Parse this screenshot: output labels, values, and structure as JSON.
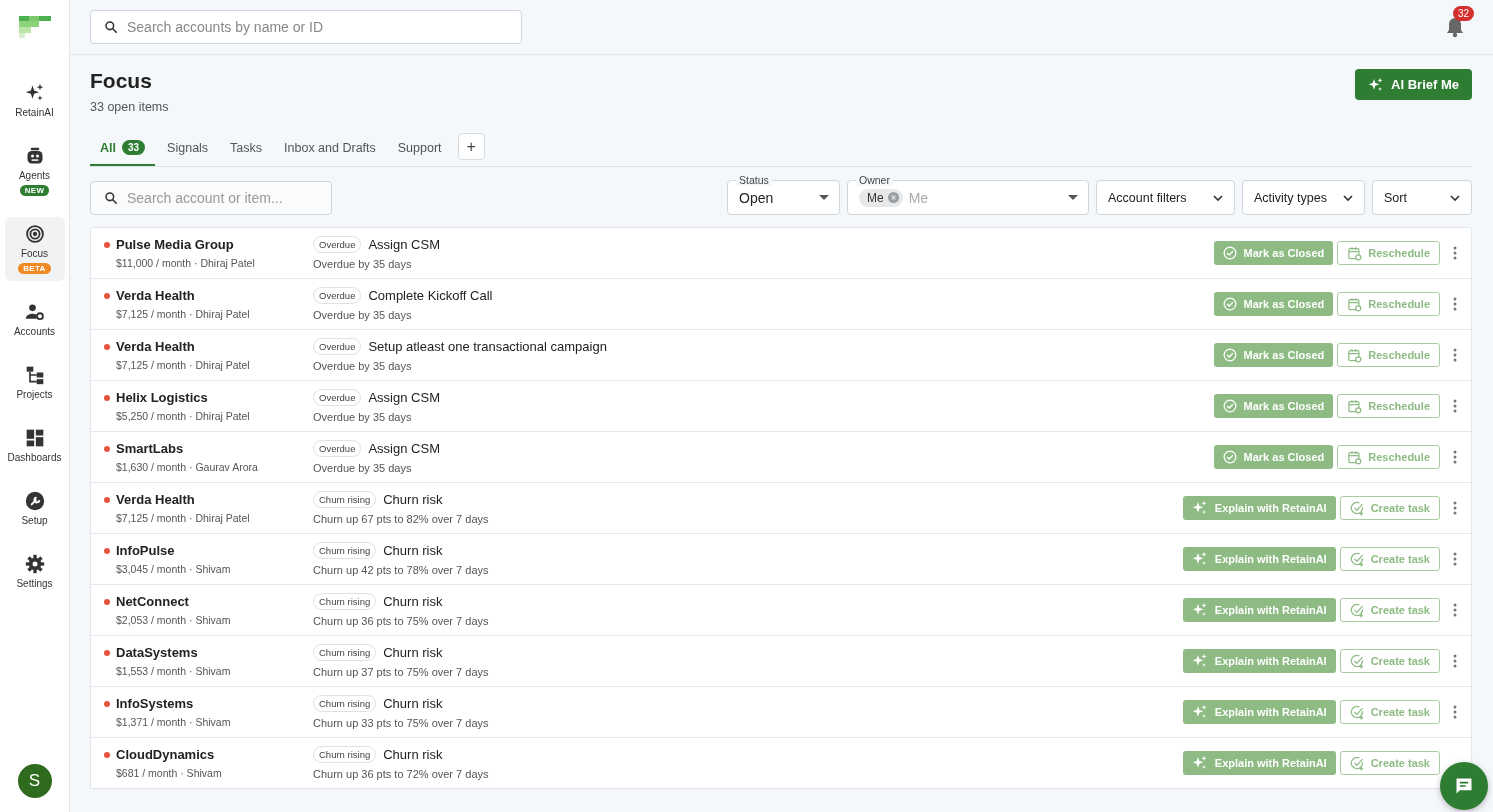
{
  "topbar": {
    "search": {
      "placeholder": "Search accounts by name or ID"
    },
    "notifications": "32"
  },
  "sidebar": {
    "items": [
      {
        "label": "RetainAI",
        "selected": false
      },
      {
        "label": "Agents",
        "badge": "NEW",
        "color": "#2e7d32",
        "selected": false
      },
      {
        "label": "Focus",
        "badge": "BETA",
        "color": "#f08a24",
        "selected": true
      },
      {
        "label": "Accounts",
        "selected": false
      },
      {
        "label": "Projects",
        "selected": false
      },
      {
        "label": "Dashboards",
        "selected": false
      },
      {
        "label": "Setup",
        "selected": false
      },
      {
        "label": "Settings",
        "selected": false
      }
    ],
    "avatar": "S"
  },
  "header": {
    "title": "Focus",
    "subtitle": "33 open items",
    "action": "AI Brief Me"
  },
  "tabs": [
    {
      "label": "All",
      "count": "33",
      "selected": true
    },
    {
      "label": "Signals",
      "selected": false
    },
    {
      "label": "Tasks",
      "selected": false
    },
    {
      "label": "Inbox and Drafts",
      "selected": false
    },
    {
      "label": "Support",
      "selected": false
    }
  ],
  "add_tab": "+",
  "filters": {
    "search": {
      "placeholder": "Search account or item..."
    },
    "status": {
      "label": "Status",
      "value": "Open"
    },
    "owner": {
      "label": "Owner",
      "chip": "Me",
      "placeholder": "Me"
    },
    "dropdowns": [
      "Account filters",
      "Activity types",
      "Sort"
    ]
  },
  "items": [
    {
      "kind": "overdue",
      "account": "Pulse Media Group",
      "meta": "$11,000 / month · Dhiraj Patel",
      "tag": "Overdue",
      "title": "Assign CSM",
      "detail": "Overdue by 35 days",
      "actions": [
        "Mark as Closed",
        "Reschedule"
      ]
    },
    {
      "kind": "overdue",
      "account": "Verda Health",
      "meta": "$7,125 / month · Dhiraj Patel",
      "tag": "Overdue",
      "title": "Complete Kickoff Call",
      "detail": "Overdue by 35 days",
      "actions": [
        "Mark as Closed",
        "Reschedule"
      ]
    },
    {
      "kind": "overdue",
      "account": "Verda Health",
      "meta": "$7,125 / month · Dhiraj Patel",
      "tag": "Overdue",
      "title": "Setup atleast one transactional campaign",
      "detail": "Overdue by 35 days",
      "actions": [
        "Mark as Closed",
        "Reschedule"
      ]
    },
    {
      "kind": "overdue",
      "account": "Helix Logistics",
      "meta": "$5,250 / month · Dhiraj Patel",
      "tag": "Overdue",
      "title": "Assign CSM",
      "detail": "Overdue by 35 days",
      "actions": [
        "Mark as Closed",
        "Reschedule"
      ]
    },
    {
      "kind": "overdue",
      "account": "SmartLabs",
      "meta": "$1,630 / month · Gaurav Arora",
      "tag": "Overdue",
      "title": "Assign CSM",
      "detail": "Overdue by 35 days",
      "actions": [
        "Mark as Closed",
        "Reschedule"
      ]
    },
    {
      "kind": "churn",
      "account": "Verda Health",
      "meta": "$7,125 / month · Dhiraj Patel",
      "tag": "Churn rising",
      "title": "Churn risk",
      "detail": "Churn up 67 pts to 82% over 7 days",
      "actions": [
        "Explain with RetainAI",
        "Create task"
      ]
    },
    {
      "kind": "churn",
      "account": "InfoPulse",
      "meta": "$3,045 / month · Shivam",
      "tag": "Churn rising",
      "title": "Churn risk",
      "detail": "Churn up 42 pts to 78% over 7 days",
      "actions": [
        "Explain with RetainAI",
        "Create task"
      ]
    },
    {
      "kind": "churn",
      "account": "NetConnect",
      "meta": "$2,053 / month · Shivam",
      "tag": "Churn rising",
      "title": "Churn risk",
      "detail": "Churn up 36 pts to 75% over 7 days",
      "actions": [
        "Explain with RetainAI",
        "Create task"
      ]
    },
    {
      "kind": "churn",
      "account": "DataSystems",
      "meta": "$1,553 / month · Shivam",
      "tag": "Churn rising",
      "title": "Churn risk",
      "detail": "Churn up 37 pts to 75% over 7 days",
      "actions": [
        "Explain with RetainAI",
        "Create task"
      ]
    },
    {
      "kind": "churn",
      "account": "InfoSystems",
      "meta": "$1,371 / month · Shivam",
      "tag": "Churn rising",
      "title": "Churn risk",
      "detail": "Churn up 33 pts to 75% over 7 days",
      "actions": [
        "Explain with RetainAI",
        "Create task"
      ]
    },
    {
      "kind": "churn",
      "account": "CloudDynamics",
      "meta": "$681 / month · Shivam",
      "tag": "Churn rising",
      "title": "Churn risk",
      "detail": "Churn up 36 pts to 72% over 7 days",
      "actions": [
        "Explain with RetainAI",
        "Create task"
      ]
    }
  ]
}
